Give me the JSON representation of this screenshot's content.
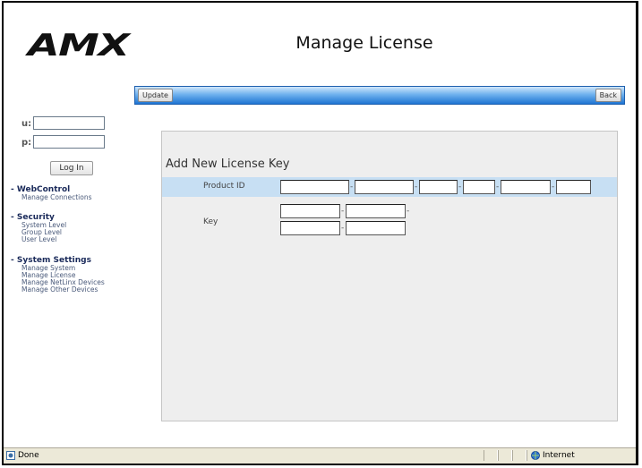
{
  "brand": {
    "logo_text": "AMX"
  },
  "page": {
    "title": "Manage License"
  },
  "login": {
    "user_label": "u:",
    "password_label": "p:",
    "user_value": "",
    "password_value": "",
    "button_label": "Log In"
  },
  "nav": {
    "webcontrol": {
      "heading": "- WebControl",
      "items": [
        "Manage Connections"
      ]
    },
    "security": {
      "heading": "- Security",
      "items": [
        "System Level",
        "Group Level",
        "User Level"
      ]
    },
    "system_settings": {
      "heading": "- System Settings",
      "items": [
        "Manage System",
        "Manage License",
        "Manage NetLinx Devices",
        "Manage Other Devices"
      ]
    }
  },
  "toolbar": {
    "update_label": "Update",
    "back_label": "Back"
  },
  "form": {
    "title": "Add New License Key",
    "product_id_label": "Product ID",
    "key_label": "Key",
    "separator": "-",
    "product_id_values": [
      "",
      "",
      "",
      "",
      "",
      ""
    ],
    "key_values": [
      "",
      "",
      "",
      ""
    ]
  },
  "status": {
    "left_text": "Done",
    "zone_text": "Internet"
  },
  "colors": {
    "toolbar_blue": "#1e74d2",
    "band_blue": "#c7dff3",
    "nav_heading": "#1a2a5a"
  }
}
